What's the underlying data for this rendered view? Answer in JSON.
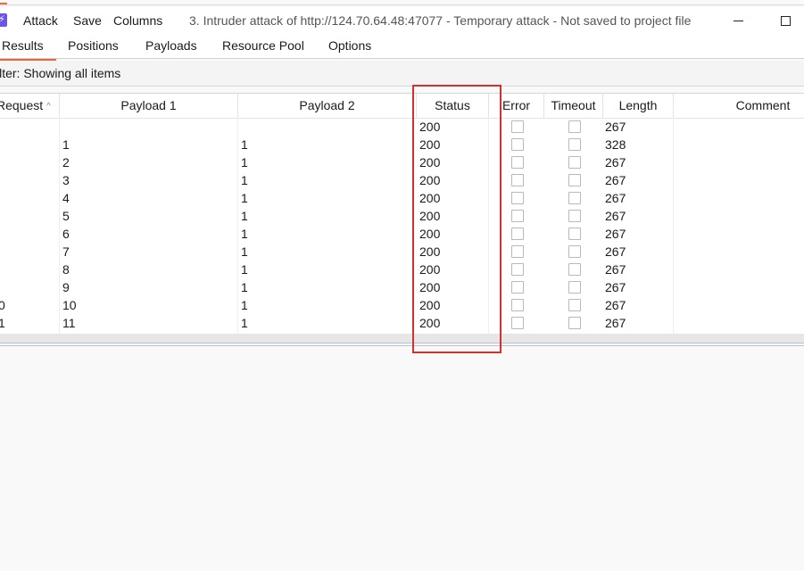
{
  "menubar": {
    "app_icon": "burp-lightning-icon",
    "items": [
      "Attack",
      "Save",
      "Columns"
    ],
    "window_title": "3. Intruder attack of http://124.70.64.48:47077 - Temporary attack - Not saved to project file"
  },
  "tabs": [
    {
      "label": "Results",
      "active": true
    },
    {
      "label": "Positions",
      "active": false
    },
    {
      "label": "Payloads",
      "active": false
    },
    {
      "label": "Resource Pool",
      "active": false
    },
    {
      "label": "Options",
      "active": false
    }
  ],
  "filter": {
    "text": "ilter: Showing all items"
  },
  "table": {
    "columns": [
      "Request",
      "Payload 1",
      "Payload 2",
      "Status",
      "Error",
      "Timeout",
      "Length",
      "Comment"
    ],
    "sort_column": "Request",
    "rows": [
      {
        "request": "",
        "payload1": "",
        "payload2": "",
        "status": "200",
        "error": false,
        "timeout": false,
        "length": "267",
        "comment": ""
      },
      {
        "request": "",
        "payload1": "1",
        "payload2": "1",
        "status": "200",
        "error": false,
        "timeout": false,
        "length": "328",
        "comment": ""
      },
      {
        "request": "",
        "payload1": "2",
        "payload2": "1",
        "status": "200",
        "error": false,
        "timeout": false,
        "length": "267",
        "comment": ""
      },
      {
        "request": "",
        "payload1": "3",
        "payload2": "1",
        "status": "200",
        "error": false,
        "timeout": false,
        "length": "267",
        "comment": ""
      },
      {
        "request": "",
        "payload1": "4",
        "payload2": "1",
        "status": "200",
        "error": false,
        "timeout": false,
        "length": "267",
        "comment": ""
      },
      {
        "request": "",
        "payload1": "5",
        "payload2": "1",
        "status": "200",
        "error": false,
        "timeout": false,
        "length": "267",
        "comment": ""
      },
      {
        "request": "",
        "payload1": "6",
        "payload2": "1",
        "status": "200",
        "error": false,
        "timeout": false,
        "length": "267",
        "comment": ""
      },
      {
        "request": "",
        "payload1": "7",
        "payload2": "1",
        "status": "200",
        "error": false,
        "timeout": false,
        "length": "267",
        "comment": ""
      },
      {
        "request": "",
        "payload1": "8",
        "payload2": "1",
        "status": "200",
        "error": false,
        "timeout": false,
        "length": "267",
        "comment": ""
      },
      {
        "request": "",
        "payload1": "9",
        "payload2": "1",
        "status": "200",
        "error": false,
        "timeout": false,
        "length": "267",
        "comment": ""
      },
      {
        "request": "0",
        "payload1": "10",
        "payload2": "1",
        "status": "200",
        "error": false,
        "timeout": false,
        "length": "267",
        "comment": ""
      },
      {
        "request": "1",
        "payload1": "11",
        "payload2": "1",
        "status": "200",
        "error": false,
        "timeout": false,
        "length": "267",
        "comment": ""
      }
    ]
  },
  "colors": {
    "accent_tab": "#e8663b",
    "highlight_box": "#d2312f",
    "app_icon": "#6a55e8"
  }
}
